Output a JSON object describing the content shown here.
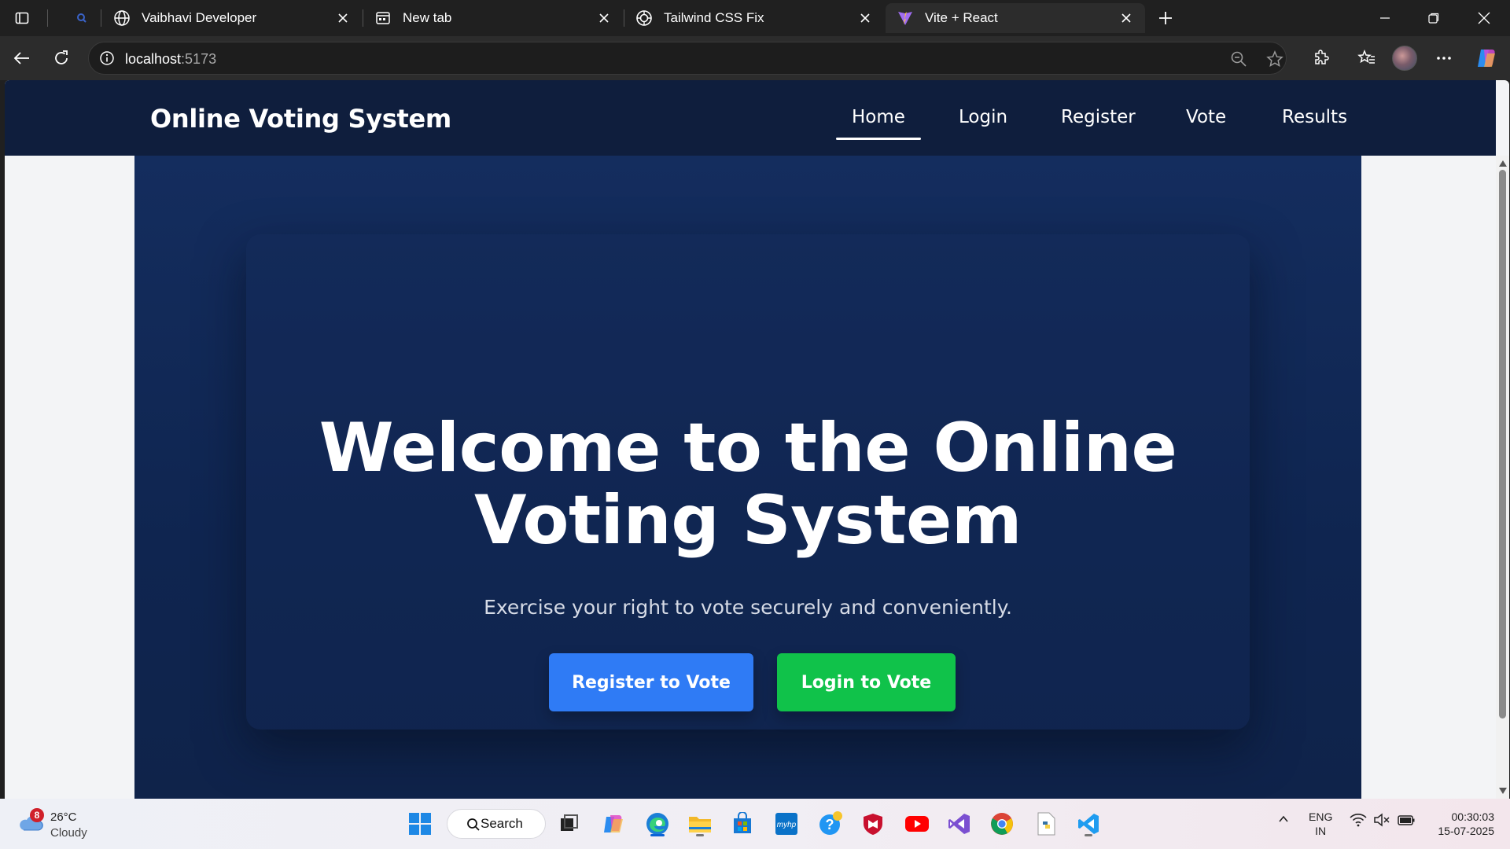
{
  "browser": {
    "tabs": [
      {
        "title": "Vaibhavi Developer",
        "icon": "globe-icon",
        "active": false
      },
      {
        "title": "New tab",
        "icon": "newtab-page-icon",
        "active": false
      },
      {
        "title": "Tailwind CSS Fix",
        "icon": "openai-icon",
        "active": false
      },
      {
        "title": "Vite + React",
        "icon": "vite-icon",
        "active": true
      }
    ],
    "address": {
      "host": "localhost",
      "port": ":5173"
    }
  },
  "site": {
    "brand": "Online Voting System",
    "nav": [
      "Home",
      "Login",
      "Register",
      "Vote",
      "Results"
    ],
    "active_nav": "Home",
    "hero": {
      "title_line1": "Welcome to the Online",
      "title_line2": "Voting System",
      "subtitle": "Exercise your right to vote securely and conveniently.",
      "primary_button": "Register to Vote",
      "secondary_button": "Login to Vote"
    },
    "colors": {
      "navbar": "#0f1e3d",
      "hero_bg": "#142d5e",
      "primary_button": "#2f7bf5",
      "secondary_button": "#10c24a"
    }
  },
  "taskbar": {
    "weather": {
      "temp": "26°C",
      "condition": "Cloudy",
      "badge": "8"
    },
    "search_label": "Search",
    "language": {
      "line1": "ENG",
      "line2": "IN"
    },
    "clock": {
      "time": "00:30:03",
      "date": "15-07-2025"
    },
    "apps": [
      "windows-start-icon",
      "task-view-icon",
      "copilot-icon",
      "edge-icon",
      "file-explorer-icon",
      "microsoft-store-icon",
      "myhp-icon",
      "help-icon",
      "mcafee-icon",
      "youtube-icon",
      "visual-studio-icon",
      "chrome-icon",
      "python-file-icon",
      "vscode-icon"
    ]
  }
}
